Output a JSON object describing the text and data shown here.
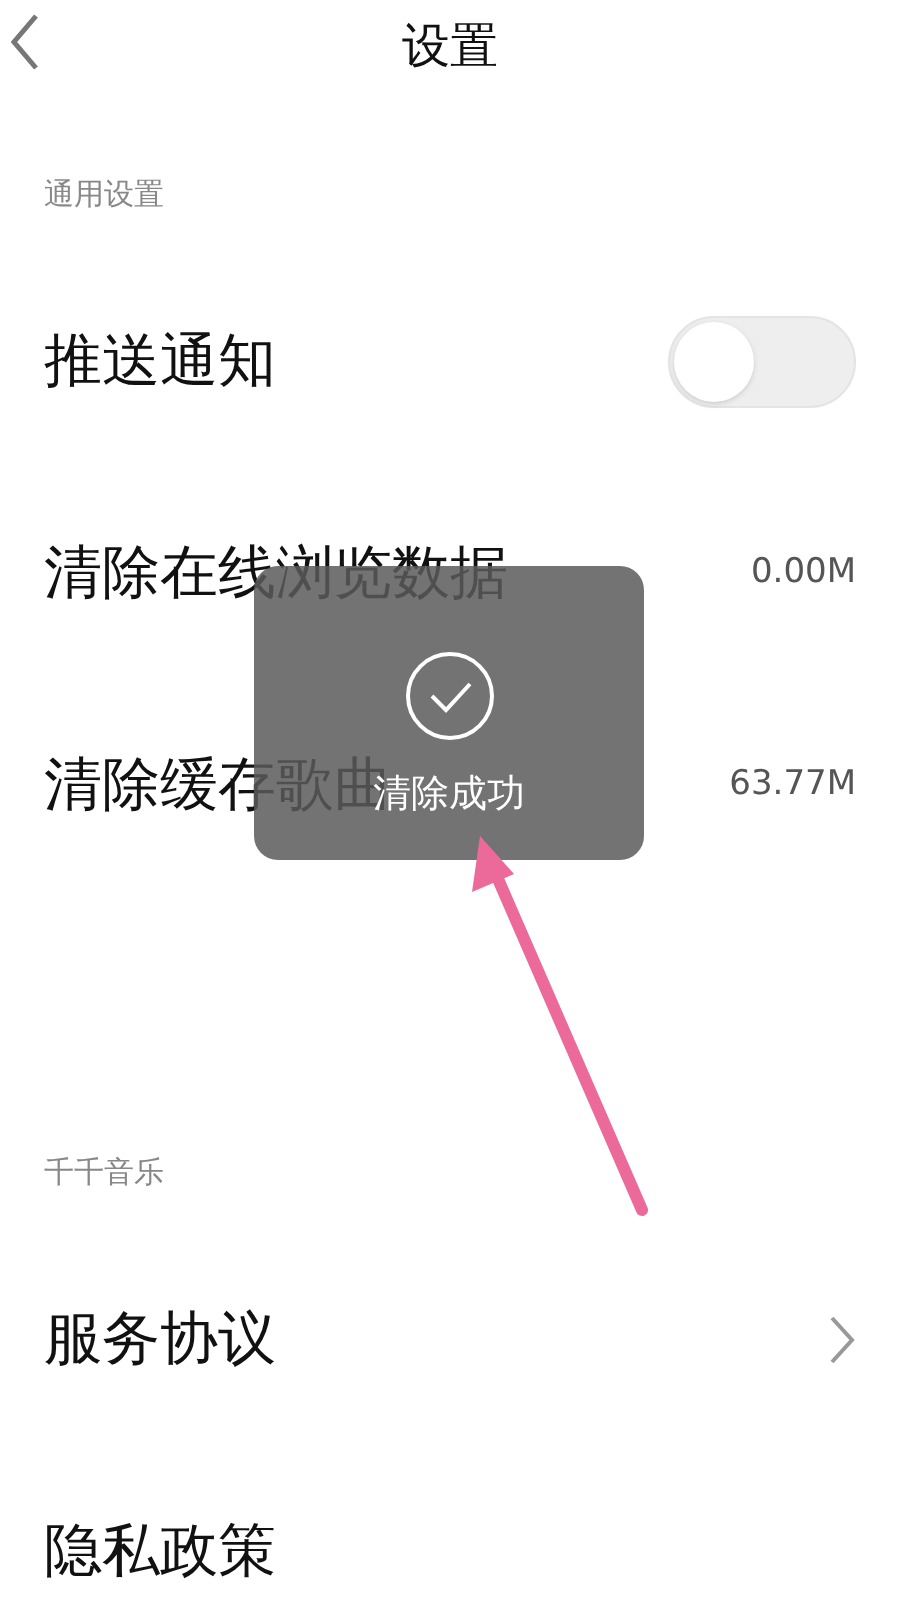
{
  "header": {
    "title": "设置"
  },
  "sections": [
    {
      "label": "通用设置",
      "rows": [
        {
          "kind": "toggle",
          "label": "推送通知",
          "on": false
        },
        {
          "kind": "value",
          "label": "清除在线浏览数据",
          "value": "0.00M"
        },
        {
          "kind": "value",
          "label": "清除缓存歌曲",
          "value": "63.77M"
        }
      ]
    },
    {
      "label": "千千音乐",
      "rows": [
        {
          "kind": "link",
          "label": "服务协议"
        },
        {
          "kind": "plain",
          "label": "隐私政策"
        }
      ]
    }
  ],
  "toast": {
    "message": "清除成功"
  }
}
